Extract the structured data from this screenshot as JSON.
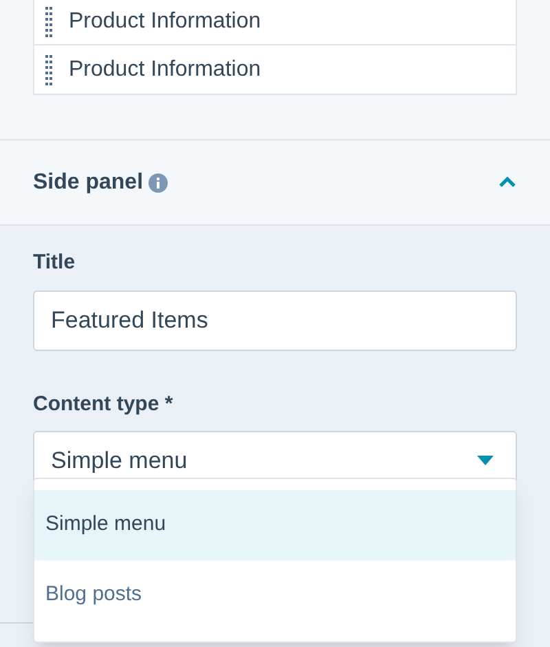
{
  "items": [
    {
      "label": "Product Information"
    },
    {
      "label": "Product Information"
    }
  ],
  "section": {
    "title": "Side panel",
    "expanded": true
  },
  "title_field": {
    "label": "Title",
    "value": "Featured Items"
  },
  "content_type": {
    "label": "Content type *",
    "value": "Simple menu",
    "open": true,
    "options": [
      {
        "label": "Simple menu",
        "selected": true
      },
      {
        "label": "Blog posts",
        "selected": false
      }
    ]
  }
}
